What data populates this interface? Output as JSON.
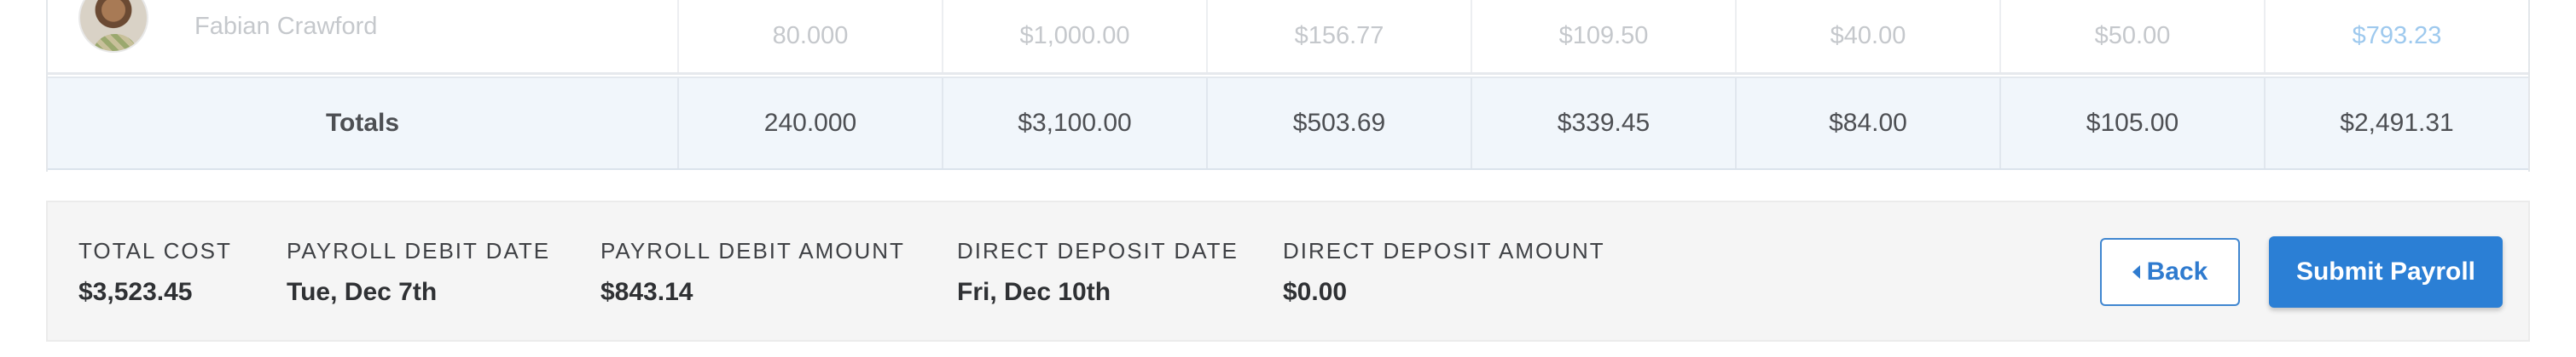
{
  "employee_row": {
    "name": "Fabian Crawford",
    "values": [
      "80.000",
      "$1,000.00",
      "$156.77",
      "$109.50",
      "$40.00",
      "$50.00",
      "$793.23"
    ]
  },
  "totals_row": {
    "label": "Totals",
    "values": [
      "240.000",
      "$3,100.00",
      "$503.69",
      "$339.45",
      "$84.00",
      "$105.00",
      "$2,491.31"
    ]
  },
  "summary": {
    "total_cost": {
      "label": "Total Cost",
      "value": "$3,523.45"
    },
    "payroll_debit_date": {
      "label": "Payroll Debit Date",
      "value": "Tue, Dec 7th"
    },
    "payroll_debit_amount": {
      "label": "Payroll Debit Amount",
      "value": "$843.14"
    },
    "direct_deposit_date": {
      "label": "Direct Deposit Date",
      "value": "Fri, Dec 10th"
    },
    "direct_deposit_amount": {
      "label": "Direct Deposit Amount",
      "value": "$0.00"
    }
  },
  "actions": {
    "back_label": "Back",
    "submit_label": "Submit Payroll"
  },
  "icons": {
    "back": "caret-left-icon",
    "avatar": "employee-photo"
  },
  "colors": {
    "accent": "#2b7fd5",
    "totals_background": "#f1f6fb",
    "summary_background": "#f5f5f5",
    "net_pay_muted": "#9ec9ee"
  }
}
